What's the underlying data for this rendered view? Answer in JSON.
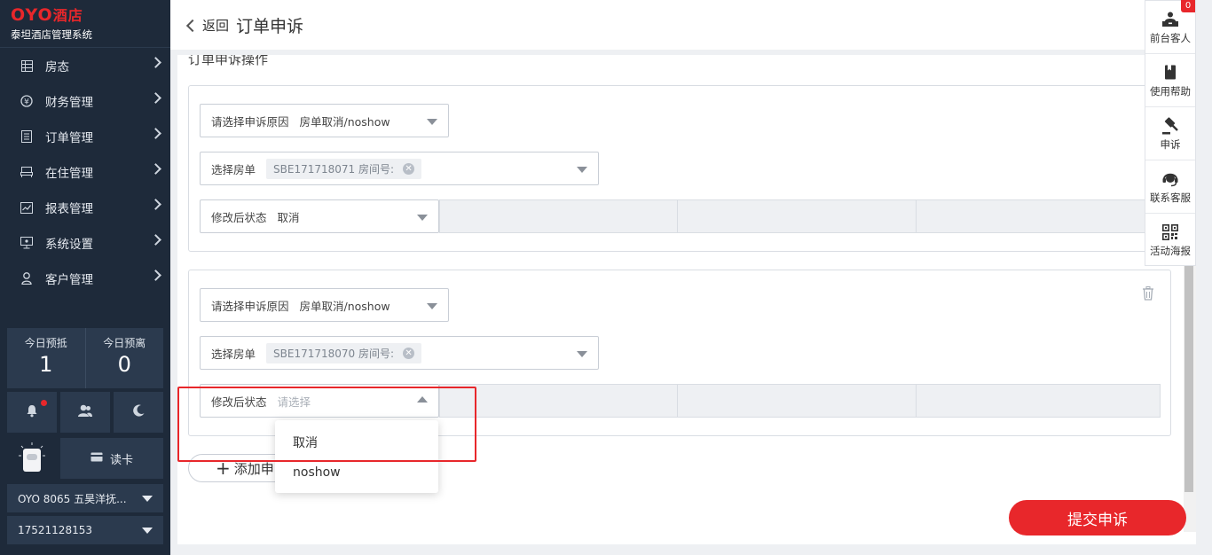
{
  "brand": {
    "logo_main": "OYO",
    "logo_suffix": "酒店",
    "system_name": "泰坦酒店管理系统"
  },
  "sidebar": {
    "items": [
      {
        "label": "房态",
        "icon": "grid-icon"
      },
      {
        "label": "财务管理",
        "icon": "yen-icon"
      },
      {
        "label": "订单管理",
        "icon": "document-icon"
      },
      {
        "label": "在住管理",
        "icon": "bed-icon"
      },
      {
        "label": "报表管理",
        "icon": "chart-icon"
      },
      {
        "label": "系统设置",
        "icon": "monitor-icon"
      },
      {
        "label": "客户管理",
        "icon": "user-icon"
      }
    ],
    "stats": [
      {
        "label": "今日预抵",
        "value": "1"
      },
      {
        "label": "今日预离",
        "value": "0"
      }
    ],
    "read_card": "读卡",
    "hotel_select": "OYO 8065 五昊洋抚...",
    "phone_select": "17521128153"
  },
  "header": {
    "back_label": "返回",
    "title": "订单申诉"
  },
  "main": {
    "section_title": "订单申诉操作",
    "blocks": [
      {
        "reason_label": "请选择申诉原因",
        "reason_value": "房单取消/noshow",
        "room_label": "选择房单",
        "room_tag": "SBE171718071 房间号:",
        "status_label": "修改后状态",
        "status_value": "取消"
      },
      {
        "reason_label": "请选择申诉原因",
        "reason_value": "房单取消/noshow",
        "room_label": "选择房单",
        "room_tag": "SBE171718070 房间号:",
        "status_label": "修改后状态",
        "status_placeholder": "请选择"
      }
    ],
    "add_button": "添加申",
    "dropdown_options": [
      "取消",
      "noshow"
    ],
    "submit_button": "提交申诉"
  },
  "float_panel": {
    "items": [
      {
        "label": "前台客人",
        "icon": "receptionist-icon",
        "badge": "0"
      },
      {
        "label": "使用帮助",
        "icon": "book-icon"
      },
      {
        "label": "申诉",
        "icon": "gavel-icon"
      },
      {
        "label": "联系客服",
        "icon": "headset-icon"
      },
      {
        "label": "活动海报",
        "icon": "qrcode-icon"
      }
    ]
  },
  "colors": {
    "sidebar_bg": "#1e2a3a",
    "accent": "#e8272b",
    "page_bg": "#eef0f3"
  }
}
